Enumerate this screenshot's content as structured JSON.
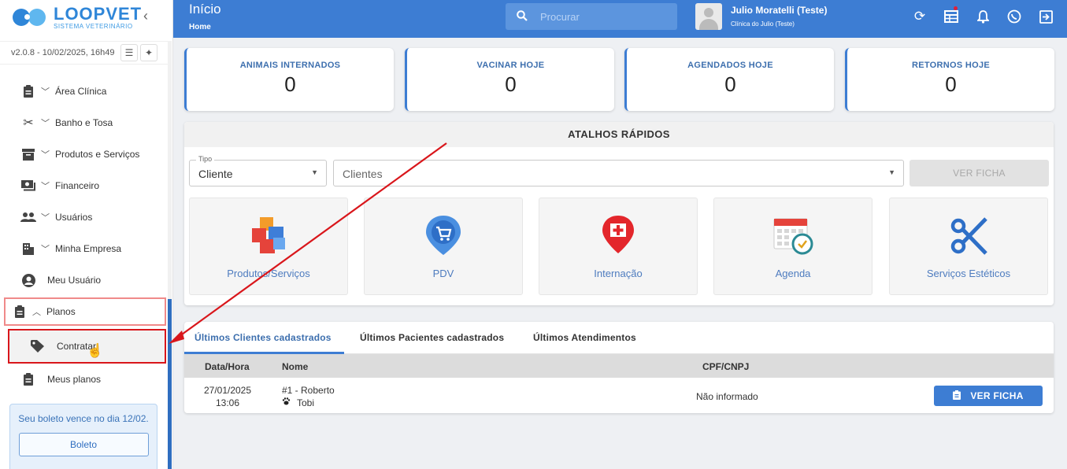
{
  "brand": {
    "title": "LOOPVET",
    "subtitle": "SISTEMA VETERINÁRIO"
  },
  "sidebar": {
    "version": "v2.0.8 - 10/02/2025, 16h49",
    "items": [
      {
        "label": "Área Clínica",
        "icon": "clipboard-icon"
      },
      {
        "label": "Banho e Tosa",
        "icon": "scissors-icon"
      },
      {
        "label": "Produtos e Serviços",
        "icon": "archive-box-icon"
      },
      {
        "label": "Financeiro",
        "icon": "money-icon"
      },
      {
        "label": "Usuários",
        "icon": "users-icon"
      },
      {
        "label": "Minha Empresa",
        "icon": "building-icon"
      },
      {
        "label": "Meu Usuário",
        "icon": "account-circle-icon"
      },
      {
        "label": "Planos",
        "icon": "clipboard-icon"
      },
      {
        "label": "Contratar",
        "icon": "tag-icon"
      },
      {
        "label": "Meus planos",
        "icon": "clipboard-icon"
      }
    ],
    "boleto_msg": "Seu boleto vence no dia 12/02.",
    "boleto_btn": "Boleto"
  },
  "header": {
    "title": "Início",
    "breadcrumb": "Home",
    "search_placeholder": "Procurar",
    "user_name": "Julio Moratelli (Teste)",
    "clinic": "Clínica do Julio (Teste)",
    "icons": [
      "sync-icon",
      "calendar-table-icon",
      "bell-icon",
      "whatsapp-icon",
      "logout-icon"
    ]
  },
  "stats": [
    {
      "label": "ANIMAIS INTERNADOS",
      "value": "0"
    },
    {
      "label": "VACINAR HOJE",
      "value": "0"
    },
    {
      "label": "AGENDADOS HOJE",
      "value": "0"
    },
    {
      "label": "RETORNOS HOJE",
      "value": "0"
    }
  ],
  "atalhos": {
    "title": "ATALHOS RÁPIDOS",
    "tipo_label": "Tipo",
    "tipo_value": "Cliente",
    "clientes_value": "Clientes",
    "ver_ficha": "VER FICHA",
    "tiles": [
      {
        "label": "Produtos/Serviços"
      },
      {
        "label": "PDV"
      },
      {
        "label": "Internação"
      },
      {
        "label": "Agenda"
      },
      {
        "label": "Serviços Estéticos"
      }
    ]
  },
  "recent": {
    "tabs": [
      "Últimos Clientes cadastrados",
      "Últimos Pacientes cadastrados",
      "Últimos Atendimentos"
    ],
    "columns": [
      "Data/Hora",
      "Nome",
      "CPF/CNPJ"
    ],
    "rows": [
      {
        "date": "27/01/2025",
        "time": "13:06",
        "name": "#1 - Roberto",
        "pet": "Tobi",
        "cpf": "Não informado",
        "action": "VER FICHA"
      }
    ]
  },
  "colors": {
    "primary": "#3d7dd3",
    "highlight": "#d9161b"
  }
}
